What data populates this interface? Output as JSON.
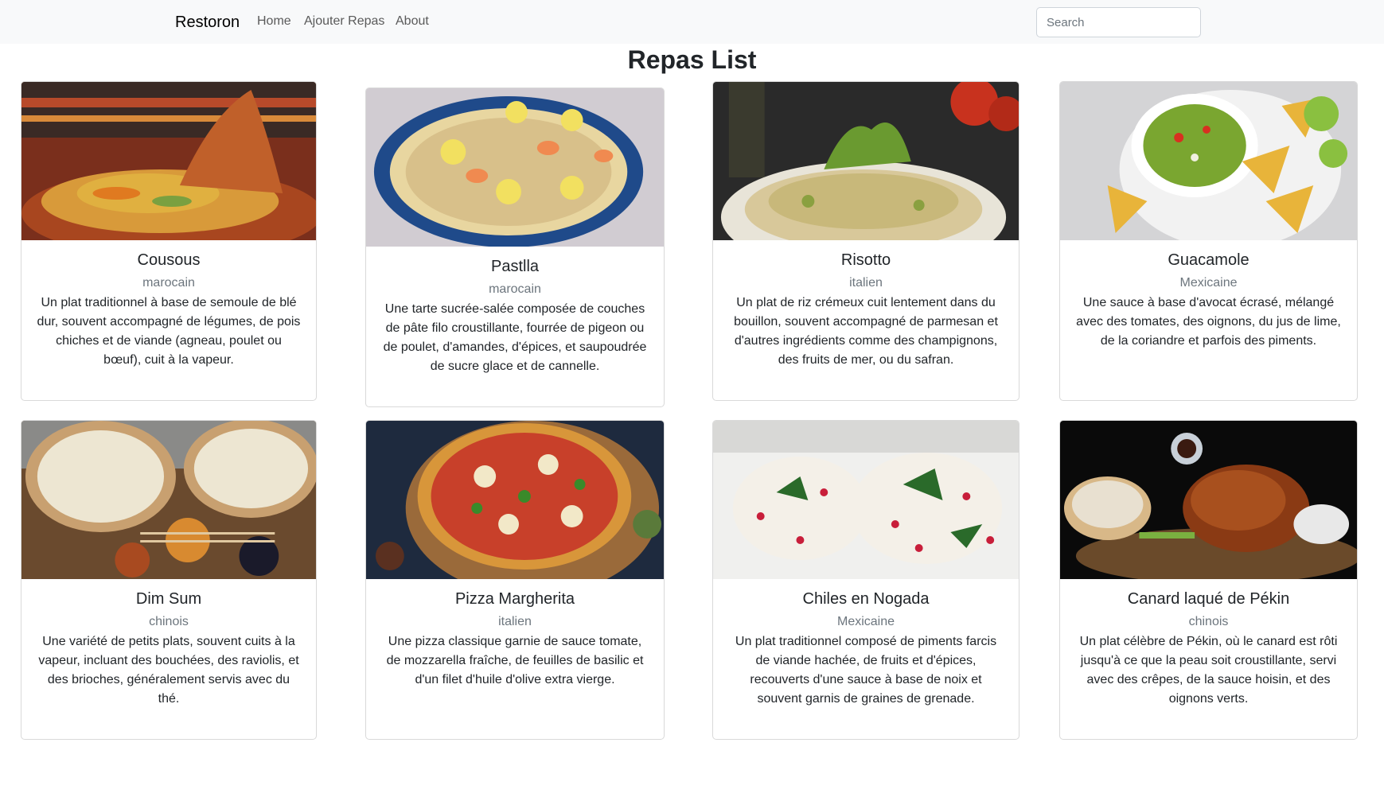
{
  "navbar": {
    "brand": "Restoron",
    "links": [
      "Home",
      "Ajouter Repas",
      "About"
    ],
    "search_placeholder": "Search"
  },
  "page": {
    "title": "Repas List"
  },
  "meals": [
    {
      "name": "Cousous",
      "cuisine": "marocain",
      "description": "Un plat traditionnel à base de semoule de blé dur, souvent accompagné de légumes, de pois chiches et de viande (agneau, poulet ou bœuf), cuit à la vapeur."
    },
    {
      "name": "Pastlla",
      "cuisine": "marocain",
      "description": "Une tarte sucrée-salée composée de couches de pâte filo croustillante, fourrée de pigeon ou de poulet, d'amandes, d'épices, et saupoudrée de sucre glace et de cannelle."
    },
    {
      "name": "Risotto",
      "cuisine": "italien",
      "description": "Un plat de riz crémeux cuit lentement dans du bouillon, souvent accompagné de parmesan et d'autres ingrédients comme des champignons, des fruits de mer, ou du safran."
    },
    {
      "name": "Guacamole",
      "cuisine": "Mexicaine",
      "description": "Une sauce à base d'avocat écrasé, mélangé avec des tomates, des oignons, du jus de lime, de la coriandre et parfois des piments."
    },
    {
      "name": "Dim Sum",
      "cuisine": "chinois",
      "description": "Une variété de petits plats, souvent cuits à la vapeur, incluant des bouchées, des raviolis, et des brioches, généralement servis avec du thé."
    },
    {
      "name": "Pizza Margherita",
      "cuisine": "italien",
      "description": "Une pizza classique garnie de sauce tomate, de mozzarella fraîche, de feuilles de basilic et d'un filet d'huile d'olive extra vierge."
    },
    {
      "name": "Chiles en Nogada",
      "cuisine": "Mexicaine",
      "description": "Un plat traditionnel composé de piments farcis de viande hachée, de fruits et d'épices, recouverts d'une sauce à base de noix et souvent garnis de graines de grenade."
    },
    {
      "name": "Canard laqué de Pékin",
      "cuisine": "chinois",
      "description": "Un plat célèbre de Pékin, où le canard est rôti jusqu'à ce que la peau soit croustillante, servi avec des crêpes, de la sauce hoisin, et des oignons verts."
    }
  ]
}
